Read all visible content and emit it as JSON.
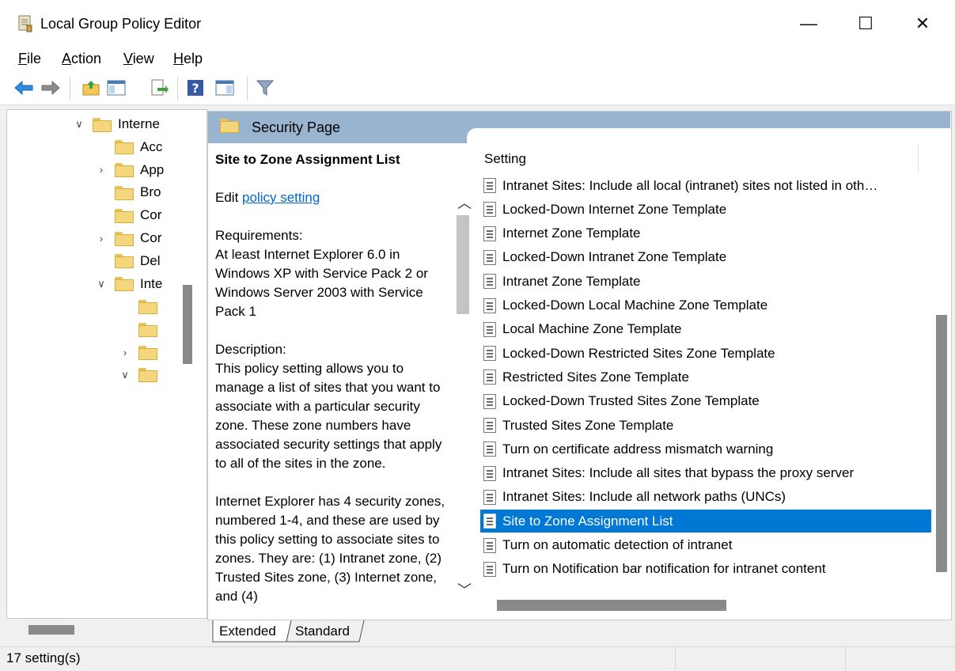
{
  "window": {
    "title": "Local Group Policy Editor",
    "minimize": "—",
    "maximize": "☐",
    "close": "✕"
  },
  "menu": {
    "items": [
      {
        "label": "File",
        "accel": "F",
        "rest": "ile"
      },
      {
        "label": "Action",
        "accel": "A",
        "rest": "ction"
      },
      {
        "label": "View",
        "accel": "V",
        "rest": "iew"
      },
      {
        "label": "Help",
        "accel": "H",
        "rest": "elp"
      }
    ]
  },
  "toolbar": {
    "icons": [
      "back-icon",
      "forward-icon",
      "up-folder-icon",
      "show-hide-tree-icon",
      "export-list-icon",
      "help-icon",
      "show-action-pane-icon",
      "filter-icon"
    ]
  },
  "tree": {
    "items": [
      {
        "label": "Interne",
        "chevron": "∨",
        "indent": 0
      },
      {
        "label": "Acc",
        "chevron": "",
        "indent": 1
      },
      {
        "label": "App",
        "chevron": "›",
        "indent": 1
      },
      {
        "label": "Bro",
        "chevron": "",
        "indent": 1
      },
      {
        "label": "Cor",
        "chevron": "",
        "indent": 1
      },
      {
        "label": "Cor",
        "chevron": "›",
        "indent": 1
      },
      {
        "label": "Del",
        "chevron": "",
        "indent": 1
      },
      {
        "label": "Inte",
        "chevron": "∨",
        "indent": 1
      },
      {
        "label": "",
        "chevron": "",
        "indent": 2
      },
      {
        "label": "",
        "chevron": "",
        "indent": 2
      },
      {
        "label": "",
        "chevron": "›",
        "indent": 2
      },
      {
        "label": "",
        "chevron": "∨",
        "indent": 2
      }
    ]
  },
  "section": {
    "title": "Security Page"
  },
  "description": {
    "heading": "Site to Zone Assignment List",
    "edit_prefix": "Edit ",
    "edit_link": "policy setting",
    "requirements_label": "Requirements:",
    "requirements_text": "At least Internet Explorer 6.0 in Windows XP with Service Pack 2 or Windows Server 2003 with Service Pack 1",
    "description_label": "Description:",
    "description_text": "This policy setting allows you to manage a list of sites that you want to associate with a particular security zone. These zone numbers have associated security settings that apply to all of the sites in the zone.",
    "description_text_2": "Internet Explorer has 4 security zones, numbered 1-4, and these are used by this policy setting to associate sites to zones. They are: (1) Intranet zone, (2) Trusted Sites zone, (3) Internet zone, and (4)"
  },
  "settings": {
    "column_header": "Setting",
    "rows": [
      {
        "label": "Intranet Sites: Include all local (intranet) sites not listed in oth…",
        "selected": false
      },
      {
        "label": "Locked-Down Internet Zone Template",
        "selected": false
      },
      {
        "label": "Internet Zone Template",
        "selected": false
      },
      {
        "label": "Locked-Down Intranet Zone Template",
        "selected": false
      },
      {
        "label": "Intranet Zone Template",
        "selected": false
      },
      {
        "label": "Locked-Down Local Machine Zone Template",
        "selected": false
      },
      {
        "label": "Local Machine Zone Template",
        "selected": false
      },
      {
        "label": "Locked-Down Restricted Sites Zone Template",
        "selected": false
      },
      {
        "label": "Restricted Sites Zone Template",
        "selected": false
      },
      {
        "label": "Locked-Down Trusted Sites Zone Template",
        "selected": false
      },
      {
        "label": "Trusted Sites Zone Template",
        "selected": false
      },
      {
        "label": "Turn on certificate address mismatch warning",
        "selected": false
      },
      {
        "label": "Intranet Sites: Include all sites that bypass the proxy server",
        "selected": false
      },
      {
        "label": "Intranet Sites: Include all network paths (UNCs)",
        "selected": false
      },
      {
        "label": "Site to Zone Assignment List",
        "selected": true
      },
      {
        "label": "Turn on automatic detection of intranet",
        "selected": false
      },
      {
        "label": "Turn on Notification bar notification for intranet content",
        "selected": false
      }
    ]
  },
  "tabs": {
    "extended": "Extended",
    "standard": "Standard",
    "active": "Extended"
  },
  "status": {
    "text": "17 setting(s)"
  },
  "colors": {
    "selection": "#0078d4",
    "header_band": "#98b4cf",
    "link": "#0066cc"
  }
}
